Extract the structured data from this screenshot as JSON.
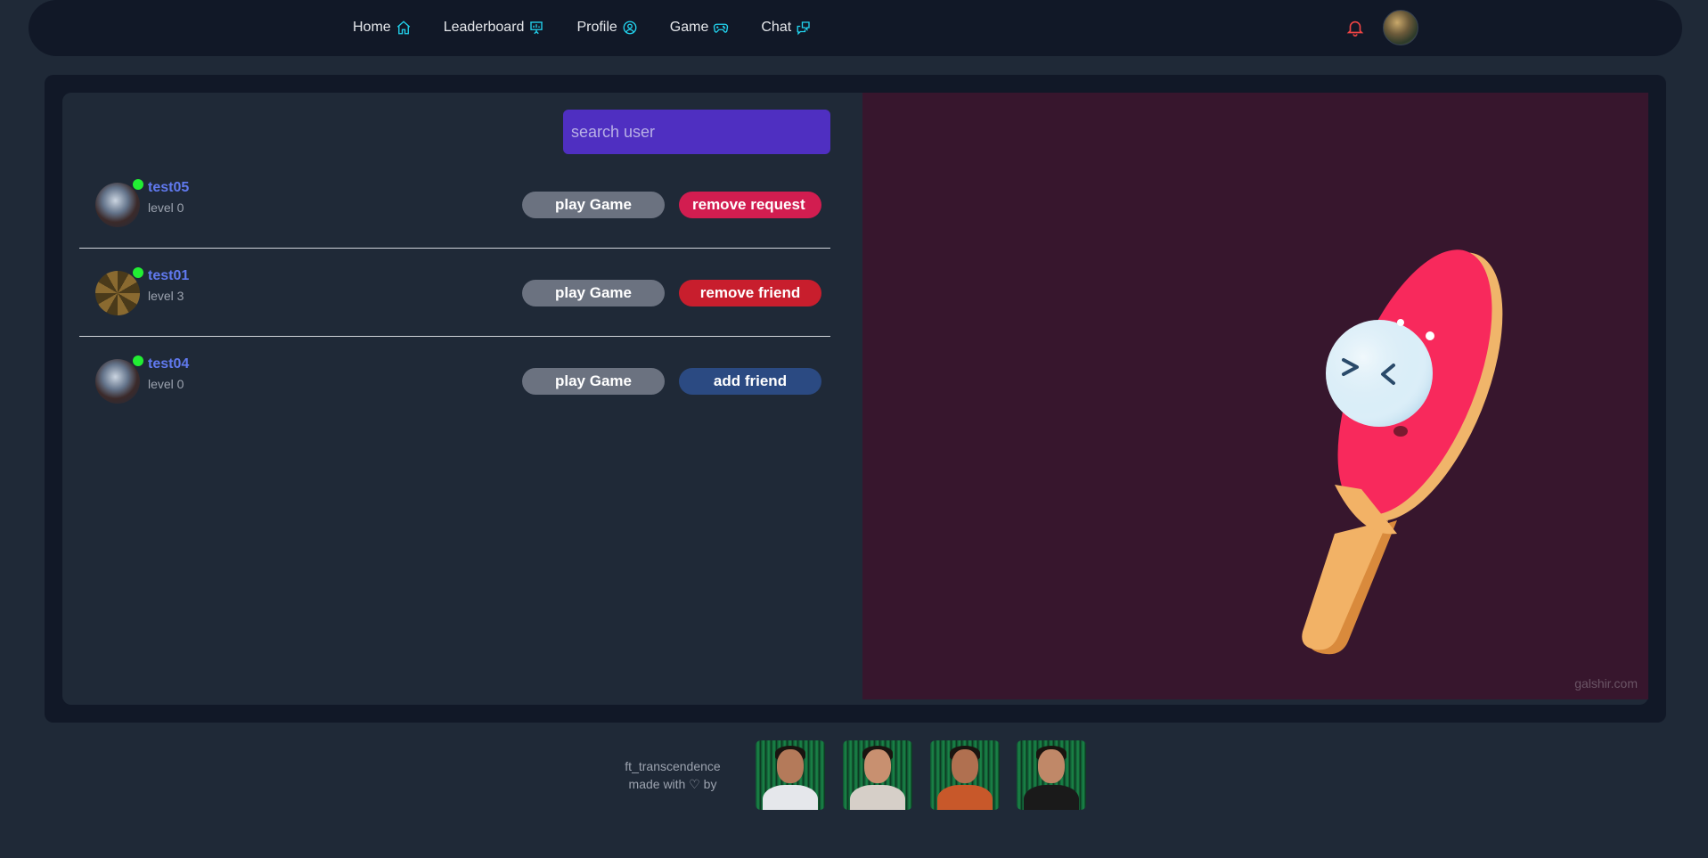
{
  "nav": {
    "links": [
      {
        "label": "Home",
        "icon": "home-icon"
      },
      {
        "label": "Leaderboard",
        "icon": "presentation-chart-icon"
      },
      {
        "label": "Profile",
        "icon": "user-circle-icon"
      },
      {
        "label": "Game",
        "icon": "gamepad-icon"
      },
      {
        "label": "Chat",
        "icon": "chat-bubbles-icon"
      }
    ],
    "notification_icon": "bell-icon",
    "avatar": "user-avatar"
  },
  "search": {
    "placeholder": "search user",
    "value": ""
  },
  "users": [
    {
      "name": "test05",
      "level": "level 0",
      "online": true,
      "play_label": "play Game",
      "action_label": "remove request"
    },
    {
      "name": "test01",
      "level": "level 3",
      "online": true,
      "play_label": "play Game",
      "action_label": "remove friend"
    },
    {
      "name": "test04",
      "level": "level 0",
      "online": true,
      "play_label": "play Game",
      "action_label": "add friend"
    }
  ],
  "game_panel": {
    "watermark": "galshir.com",
    "illustration": "ping-pong-paddle-and-ball"
  },
  "footer": {
    "line1": "ft_transcendence",
    "line2": "made with ♡ by",
    "members": 4
  },
  "colors": {
    "background": "#1f2937",
    "navbar": "#111827",
    "search": "#4f2fc1",
    "username": "#6079ee",
    "online": "#22ee33",
    "play_button": "#6b7280",
    "remove_request": "#d21d50",
    "remove_friend": "#c81e2d",
    "add_friend": "#2b4a82",
    "game_panel": "#37162d",
    "nav_icon": "#22d3ee",
    "bell": "#ef4444"
  }
}
